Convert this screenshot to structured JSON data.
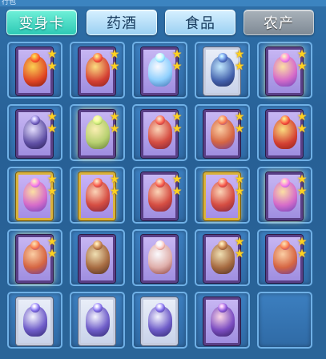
{
  "header": {
    "title_fragment": "行包"
  },
  "tabs": [
    {
      "label": "变身卡",
      "active": true
    },
    {
      "label": "药酒",
      "active": false
    },
    {
      "label": "食品",
      "active": false
    },
    {
      "label": "农产",
      "active": false,
      "disabled_look": true
    }
  ],
  "colors": {
    "active_tab": "#3fd9c3",
    "tab": "#b6def7",
    "disabled_tab": "#8e98a2",
    "star": "#ffd21f"
  },
  "slots": [
    {
      "icon": "fire-demon-card-icon",
      "stars": 2,
      "frame": "purple"
    },
    {
      "icon": "dragon-card-icon",
      "stars": 2,
      "frame": "purple"
    },
    {
      "icon": "unicorn-rider-card-icon",
      "stars": 2,
      "frame": "purple"
    },
    {
      "icon": "ice-beast-card-icon",
      "stars": 2,
      "frame": "silver"
    },
    {
      "icon": "fairy-card-icon",
      "stars": 2,
      "frame": "purple",
      "glow": true
    },
    {
      "icon": "ninja-card-icon",
      "stars": 2,
      "frame": "purple"
    },
    {
      "icon": "monk-card-icon",
      "stars": 2,
      "frame": "purple",
      "glow": true
    },
    {
      "icon": "red-girl-card-icon",
      "stars": 2,
      "frame": "purple"
    },
    {
      "icon": "bird-spirit-card-icon",
      "stars": 2,
      "frame": "purple"
    },
    {
      "icon": "dragon-card-icon",
      "stars": 2,
      "frame": "purple"
    },
    {
      "icon": "fairy-card-icon",
      "stars": 2,
      "frame": "gold"
    },
    {
      "icon": "red-girl-card-icon",
      "stars": 2,
      "frame": "gold"
    },
    {
      "icon": "red-girl-card-icon",
      "stars": 2,
      "frame": "purple"
    },
    {
      "icon": "red-girl-card-icon",
      "stars": 2,
      "frame": "gold"
    },
    {
      "icon": "fairy-card-icon",
      "stars": 2,
      "frame": "purple",
      "glow": true
    },
    {
      "icon": "bird-spirit-card-icon",
      "stars": 2,
      "frame": "purple",
      "glow": true
    },
    {
      "icon": "armored-knight-card-icon",
      "stars": 0,
      "frame": "purple"
    },
    {
      "icon": "white-priestess-card-icon",
      "stars": 0,
      "frame": "purple"
    },
    {
      "icon": "mounted-knight-card-icon",
      "stars": 2,
      "frame": "purple"
    },
    {
      "icon": "bird-spirit-card-icon",
      "stars": 2,
      "frame": "purple"
    },
    {
      "icon": "purple-warrior-card-icon",
      "stars": 0,
      "frame": "silver"
    },
    {
      "icon": "purple-warrior-card-icon",
      "stars": 0,
      "frame": "silver"
    },
    {
      "icon": "purple-warrior-card-icon",
      "stars": 0,
      "frame": "silver"
    },
    {
      "icon": "dancer-card-icon",
      "stars": 0,
      "frame": "purple"
    },
    {
      "icon": "",
      "stars": 0,
      "frame": "empty"
    }
  ]
}
